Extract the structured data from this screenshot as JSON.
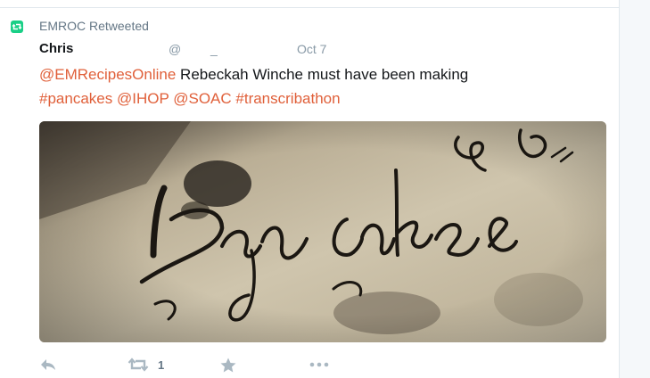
{
  "context": {
    "label": "EMROC Retweeted",
    "icon": "retweet-icon"
  },
  "author": {
    "fullname": "Chris",
    "username": "@",
    "username_tail": "_",
    "time": "Oct 7"
  },
  "text": {
    "mention_1": "@EMRecipesOnline",
    "plain_1": " Rebeckah Winche must have been making",
    "hashtag_1": "#pancakes",
    "mention_2": "@IHOP",
    "mention_3": "@SOAC",
    "hashtag_2": "#transcribathon"
  },
  "media": {
    "handwriting": "Pan cakes",
    "corner_mark": "& of"
  },
  "actions": {
    "reply_icon": "reply-icon",
    "retweet_icon": "retweet-icon",
    "retweet_count": "1",
    "favorite_icon": "star-icon",
    "more_icon": "more-icon"
  },
  "colors": {
    "link": "#e0603a",
    "retweet_green": "#19cf86",
    "muted": "#8899a6",
    "action_gray": "#aab8c2"
  }
}
